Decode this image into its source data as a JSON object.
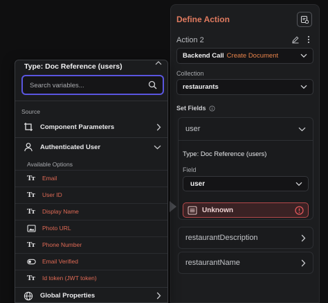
{
  "action_panel": {
    "title": "Define Action",
    "action_name": "Action 2",
    "backend_call": {
      "label": "Backend Call",
      "value": "Create Document"
    },
    "collection": {
      "label": "Collection",
      "value": "restaurants"
    },
    "set_fields_label": "Set Fields",
    "user_field": {
      "title": "user",
      "type_text": "Type: Doc Reference (users)",
      "field_label": "Field",
      "field_value": "user",
      "status": "Unknown"
    },
    "other_fields": [
      "restaurantDescription",
      "restaurantName"
    ]
  },
  "picker": {
    "title": "Type: Doc Reference (users)",
    "search_placeholder": "Search variables...",
    "source_label": "Source",
    "sections": {
      "component_parameters": "Component Parameters",
      "authenticated_user": "Authenticated User",
      "global_properties": "Global Properties"
    },
    "available_label": "Available Options",
    "options": [
      {
        "label": "Email",
        "icon": "text-type-icon"
      },
      {
        "label": "User ID",
        "icon": "text-type-icon"
      },
      {
        "label": "Display Name",
        "icon": "text-type-icon"
      },
      {
        "label": "Photo URL",
        "icon": "image-icon"
      },
      {
        "label": "Phone Number",
        "icon": "text-type-icon"
      },
      {
        "label": "Email Verified",
        "icon": "toggle-icon"
      },
      {
        "label": "Id token (JWT token)",
        "icon": "text-type-icon"
      }
    ]
  },
  "colors": {
    "accent_orange": "#e07a5f",
    "option_red": "#e06a55",
    "focus_purple": "#5a56e0",
    "error_border": "#b5494b"
  }
}
